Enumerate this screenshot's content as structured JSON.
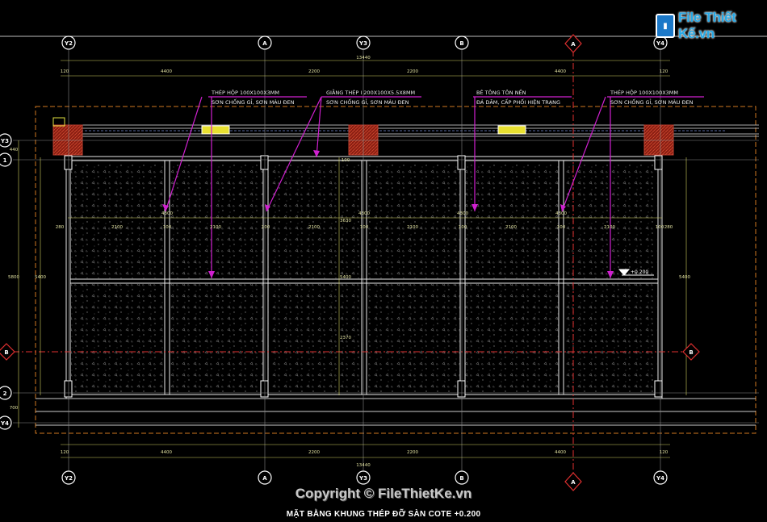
{
  "watermark": {
    "logo_text": "File Thiết Kế.vn",
    "copyright": "Copyright © FileThietKe.vn"
  },
  "sheet_title": "MẶT BẰNG KHUNG THÉP ĐỠ SÀN COTE +0.200",
  "grid_top": [
    "Y2",
    "A",
    "Y3",
    "B",
    "A",
    "Y4"
  ],
  "grid_bottom": [
    "Y2",
    "A",
    "Y3",
    "B",
    "A",
    "Y4"
  ],
  "grid_left": [
    "Y3",
    "1",
    "B",
    "2",
    "Y4"
  ],
  "grid_right": [
    "B"
  ],
  "dims_top": [
    "120",
    "4400",
    "2200",
    "2200",
    "4400",
    "120"
  ],
  "overall_dim": "13440",
  "dims_bottom": [
    "120",
    "4400",
    "2200",
    "2200",
    "4400",
    "120"
  ],
  "dims_row": [
    "280",
    "2100",
    "100",
    "2100",
    "100",
    "2100",
    "100",
    "2100",
    "100",
    "2100",
    "100",
    "2100",
    "100",
    "280"
  ],
  "dims_vertical": [
    "4300",
    "4300",
    "4300",
    "4300"
  ],
  "dims_left": [
    "440",
    "5400",
    "5800",
    "700"
  ],
  "dims_center": [
    "5400",
    "3630",
    "2370",
    "100"
  ],
  "dims_right": [
    "5400"
  ],
  "annotations": [
    {
      "line1": "THÉP HỘP 100X100X3MM",
      "line2": "SƠN CHỐNG GỈ, SƠN MÀU ĐEN"
    },
    {
      "line1": "GIẰNG THÉP I 200X100X5.5X8MM",
      "line2": "SƠN CHỐNG GỈ, SƠN MÀU ĐEN"
    },
    {
      "line1": "BÊ TÔNG TÔN NỀN",
      "line2": "ĐÁ DĂM, CẤP PHỐI HIỆN TRẠNG"
    },
    {
      "line1": "THÉP HỘP 100X100X3MM",
      "line2": "SƠN CHỐNG GỈ, SƠN MÀU ĐEN"
    }
  ],
  "level_mark": "+0.200",
  "colors": {
    "background": "#000000",
    "grid_axis": "#e03030",
    "leader": "#d020d0",
    "structure": "#ffffff",
    "boundary": "#d07820",
    "dimension": "#e0e060",
    "column": "#b03020"
  }
}
